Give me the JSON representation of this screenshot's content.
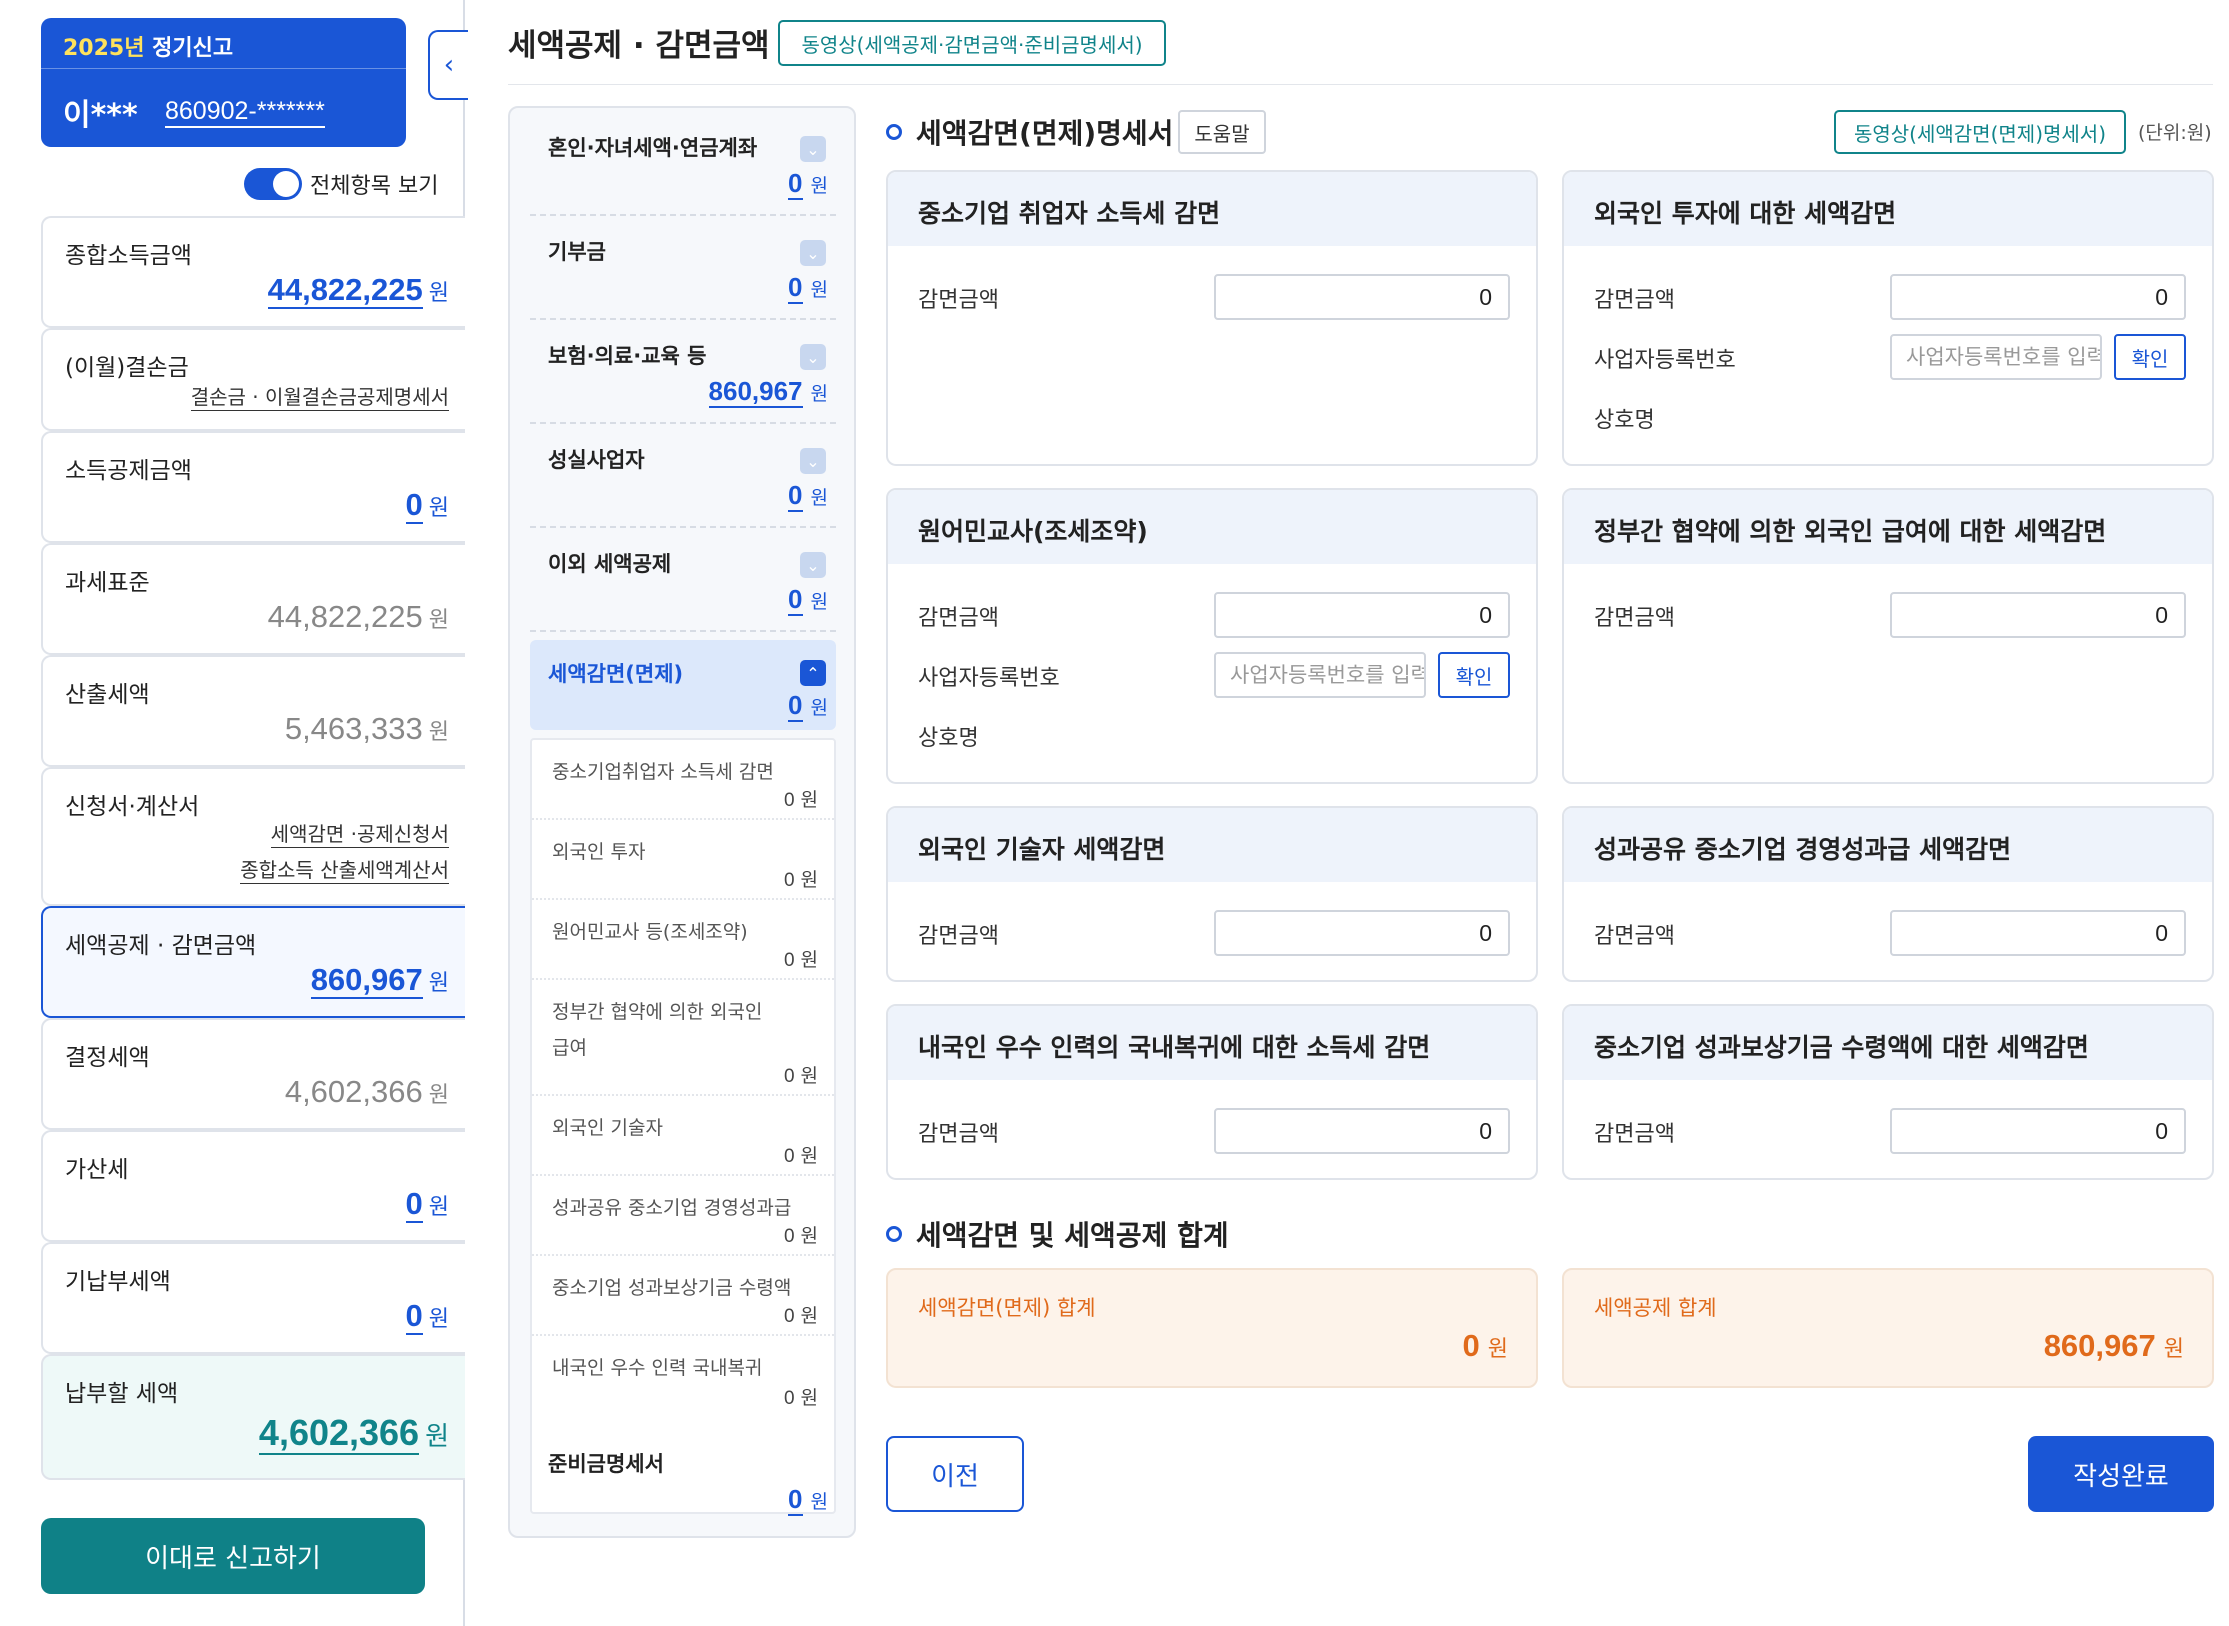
{
  "user": {
    "period_year": "2025년",
    "period_label": "정기신고",
    "name": "이***",
    "rrn": "860902-*******"
  },
  "toggle_label": "전체항목 보기",
  "summary": {
    "gross_income": {
      "label": "종합소득금액",
      "value": "44,822,225",
      "unit": "원"
    },
    "loss": {
      "label": "(이월)결손금",
      "link": "결손금 · 이월결손금공제명세서"
    },
    "income_deduction": {
      "label": "소득공제금액",
      "value": "0",
      "unit": "원"
    },
    "tax_base": {
      "label": "과세표준",
      "value": "44,822,225",
      "unit": "원"
    },
    "calculated_tax": {
      "label": "산출세액",
      "value": "5,463,333",
      "unit": "원"
    },
    "forms": {
      "label": "신청서·계산서",
      "link1": "세액감면 ·공제신청서",
      "link2": "종합소득 산출세액계산서"
    },
    "credit_reduction": {
      "label": "세액공제 · 감면금액",
      "value": "860,967",
      "unit": "원"
    },
    "determined_tax": {
      "label": "결정세액",
      "value": "4,602,366",
      "unit": "원"
    },
    "penalty": {
      "label": "가산세",
      "value": "0",
      "unit": "원"
    },
    "prepaid": {
      "label": "기납부세액",
      "value": "0",
      "unit": "원"
    },
    "payable": {
      "label": "납부할 세액",
      "value": "4,602,366",
      "unit": "원"
    }
  },
  "report_button": "이대로 신고하기",
  "header": {
    "title": "세액공제 · 감면금액",
    "video_button": "동영상(세액공제·감면금액·준비금명세서)"
  },
  "nav": {
    "items": [
      {
        "label": "혼인·자녀세액·연금계좌",
        "value": "0",
        "unit": "원"
      },
      {
        "label": "기부금",
        "value": "0",
        "unit": "원"
      },
      {
        "label": "보험·의료·교육 등",
        "value": "860,967",
        "unit": "원"
      },
      {
        "label": "성실사업자",
        "value": "0",
        "unit": "원"
      },
      {
        "label": "이외 세액공제",
        "value": "0",
        "unit": "원"
      },
      {
        "label": "세액감면(면제)",
        "value": "0",
        "unit": "원"
      }
    ],
    "sub_items": [
      {
        "label": "중소기업취업자 소득세 감면",
        "value": "0",
        "unit": "원"
      },
      {
        "label": "외국인 투자",
        "value": "0",
        "unit": "원"
      },
      {
        "label": "원어민교사 등(조세조약)",
        "value": "0",
        "unit": "원"
      },
      {
        "label": "정부간 협약에 의한 외국인",
        "label2": "급여",
        "value": "0",
        "unit": "원"
      },
      {
        "label": "외국인 기술자",
        "value": "0",
        "unit": "원"
      },
      {
        "label": "성과공유 중소기업 경영성과급",
        "value": "0",
        "unit": "원"
      },
      {
        "label": "중소기업 성과보상기금 수령액",
        "value": "0",
        "unit": "원"
      },
      {
        "label": "내국인 우수 인력 국내복귀",
        "value": "0",
        "unit": "원"
      }
    ],
    "reserve": {
      "label": "준비금명세서",
      "value": "0",
      "unit": "원"
    }
  },
  "section1": {
    "title": "세액감면(면제)명세서",
    "help": "도움말",
    "video": "동영상(세액감면(면제)명세서)",
    "unit": "(단위:원)"
  },
  "cards": {
    "sme": {
      "title": "중소기업 취업자 소득세 감면",
      "amount_label": "감면금액",
      "amount": "0"
    },
    "foreign_invest": {
      "title": "외국인 투자에 대한 세액감면",
      "amount_label": "감면금액",
      "amount": "0",
      "biz_label": "사업자등록번호",
      "biz_placeholder": "사업자등록번호를 입력",
      "confirm": "확인",
      "company_label": "상호명"
    },
    "native_teacher": {
      "title": "원어민교사(조세조약)",
      "amount_label": "감면금액",
      "amount": "0",
      "biz_label": "사업자등록번호",
      "biz_placeholder": "사업자등록번호를 입력",
      "confirm": "확인",
      "company_label": "상호명"
    },
    "govt_agreement": {
      "title": "정부간 협약에 의한 외국인 급여에 대한 세액감면",
      "amount_label": "감면금액",
      "amount": "0"
    },
    "foreign_engineer": {
      "title": "외국인 기술자 세액감면",
      "amount_label": "감면금액",
      "amount": "0"
    },
    "profit_share": {
      "title": "성과공유 중소기업 경영성과급 세액감면",
      "amount_label": "감면금액",
      "amount": "0"
    },
    "talent_return": {
      "title": "내국인 우수 인력의 국내복귀에 대한 소득세 감면",
      "amount_label": "감면금액",
      "amount": "0"
    },
    "reward_fund": {
      "title": "중소기업 성과보상기금 수령액에 대한  세액감면",
      "amount_label": "감면금액",
      "amount": "0"
    }
  },
  "section2": {
    "title": "세액감면 및 세액공제 합계"
  },
  "totals": {
    "reduction": {
      "label": "세액감면(면제) 합계",
      "value": "0",
      "unit": "원"
    },
    "credit": {
      "label": "세액공제 합계",
      "value": "860,967",
      "unit": "원"
    }
  },
  "buttons": {
    "prev": "이전",
    "done": "작성완료"
  }
}
